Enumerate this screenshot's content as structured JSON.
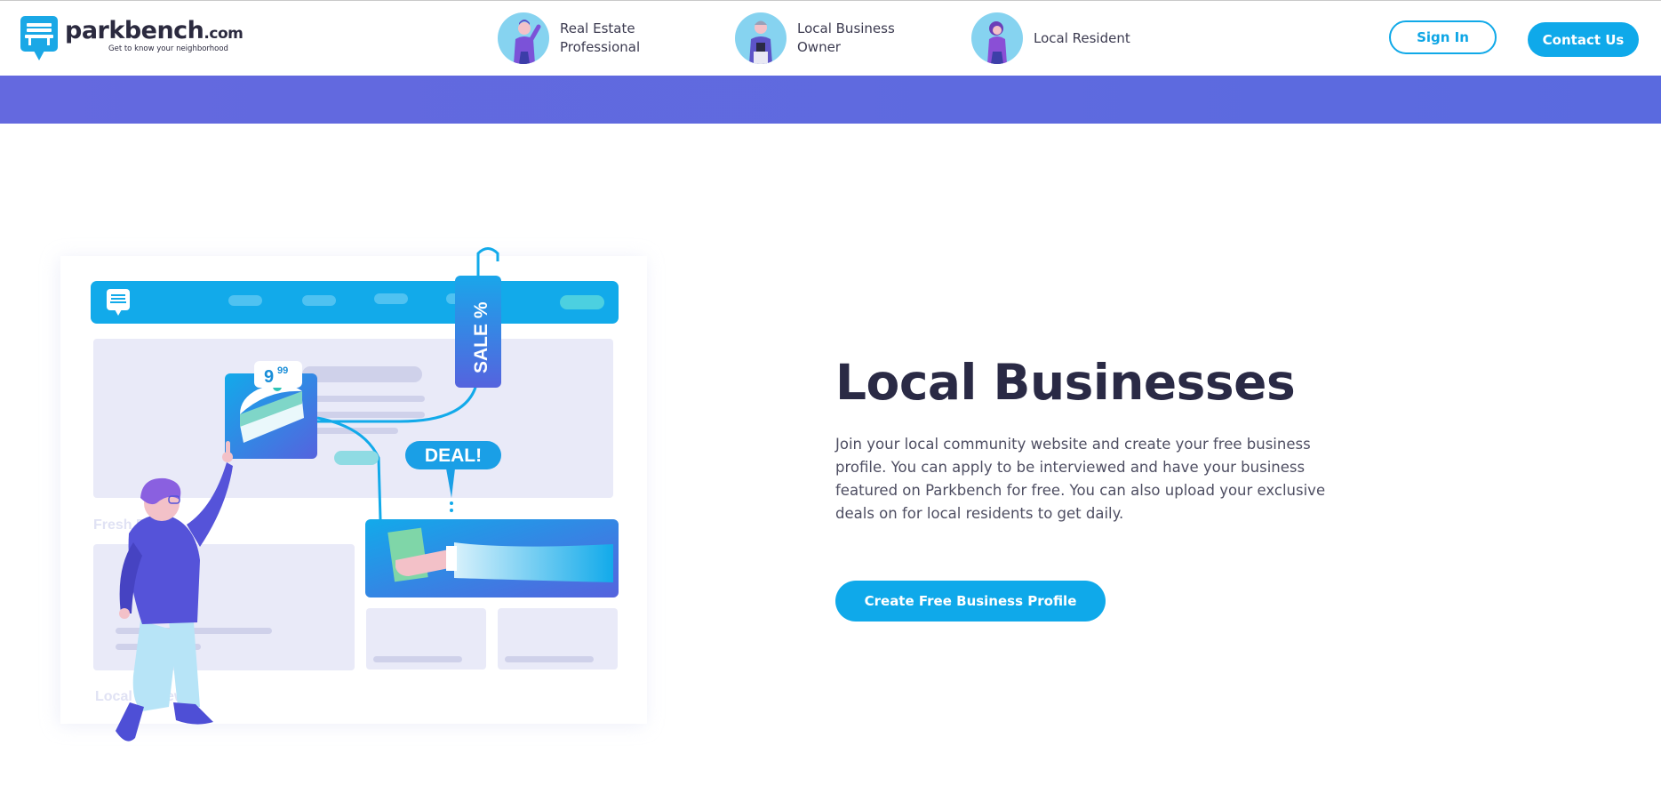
{
  "brand": {
    "name": "parkbench",
    "tld": ".com",
    "tagline": "Get to know your neighborhood",
    "color": "#0fa9ea"
  },
  "nav": {
    "personas": [
      {
        "label": "Real Estate Professional",
        "icon": "real-estate-avatar"
      },
      {
        "label": "Local Business Owner",
        "icon": "business-owner-avatar"
      },
      {
        "label": "Local Resident",
        "icon": "resident-avatar"
      }
    ],
    "sign_in": "Sign In",
    "contact": "Contact Us"
  },
  "hero": {
    "title": "Local Businesses",
    "description": "Join your local community website and create your free business profile. You can apply to be interviewed and have your business featured on Parkbench for free. You can also upload your exclusive deals on for local residents to get daily.",
    "cta": "Create Free Business Profile"
  },
  "illustration": {
    "price_main": "9",
    "price_cents": "99",
    "sale_tag": "SALE %",
    "deal_tag": "DEAL!",
    "section_1": "Fresh Deals",
    "section_2": "Local Reviews"
  },
  "colors": {
    "banner": "#5f69df",
    "accent": "#0fa9ea",
    "heading": "#2a2a45",
    "body_text": "#4e4e62"
  }
}
